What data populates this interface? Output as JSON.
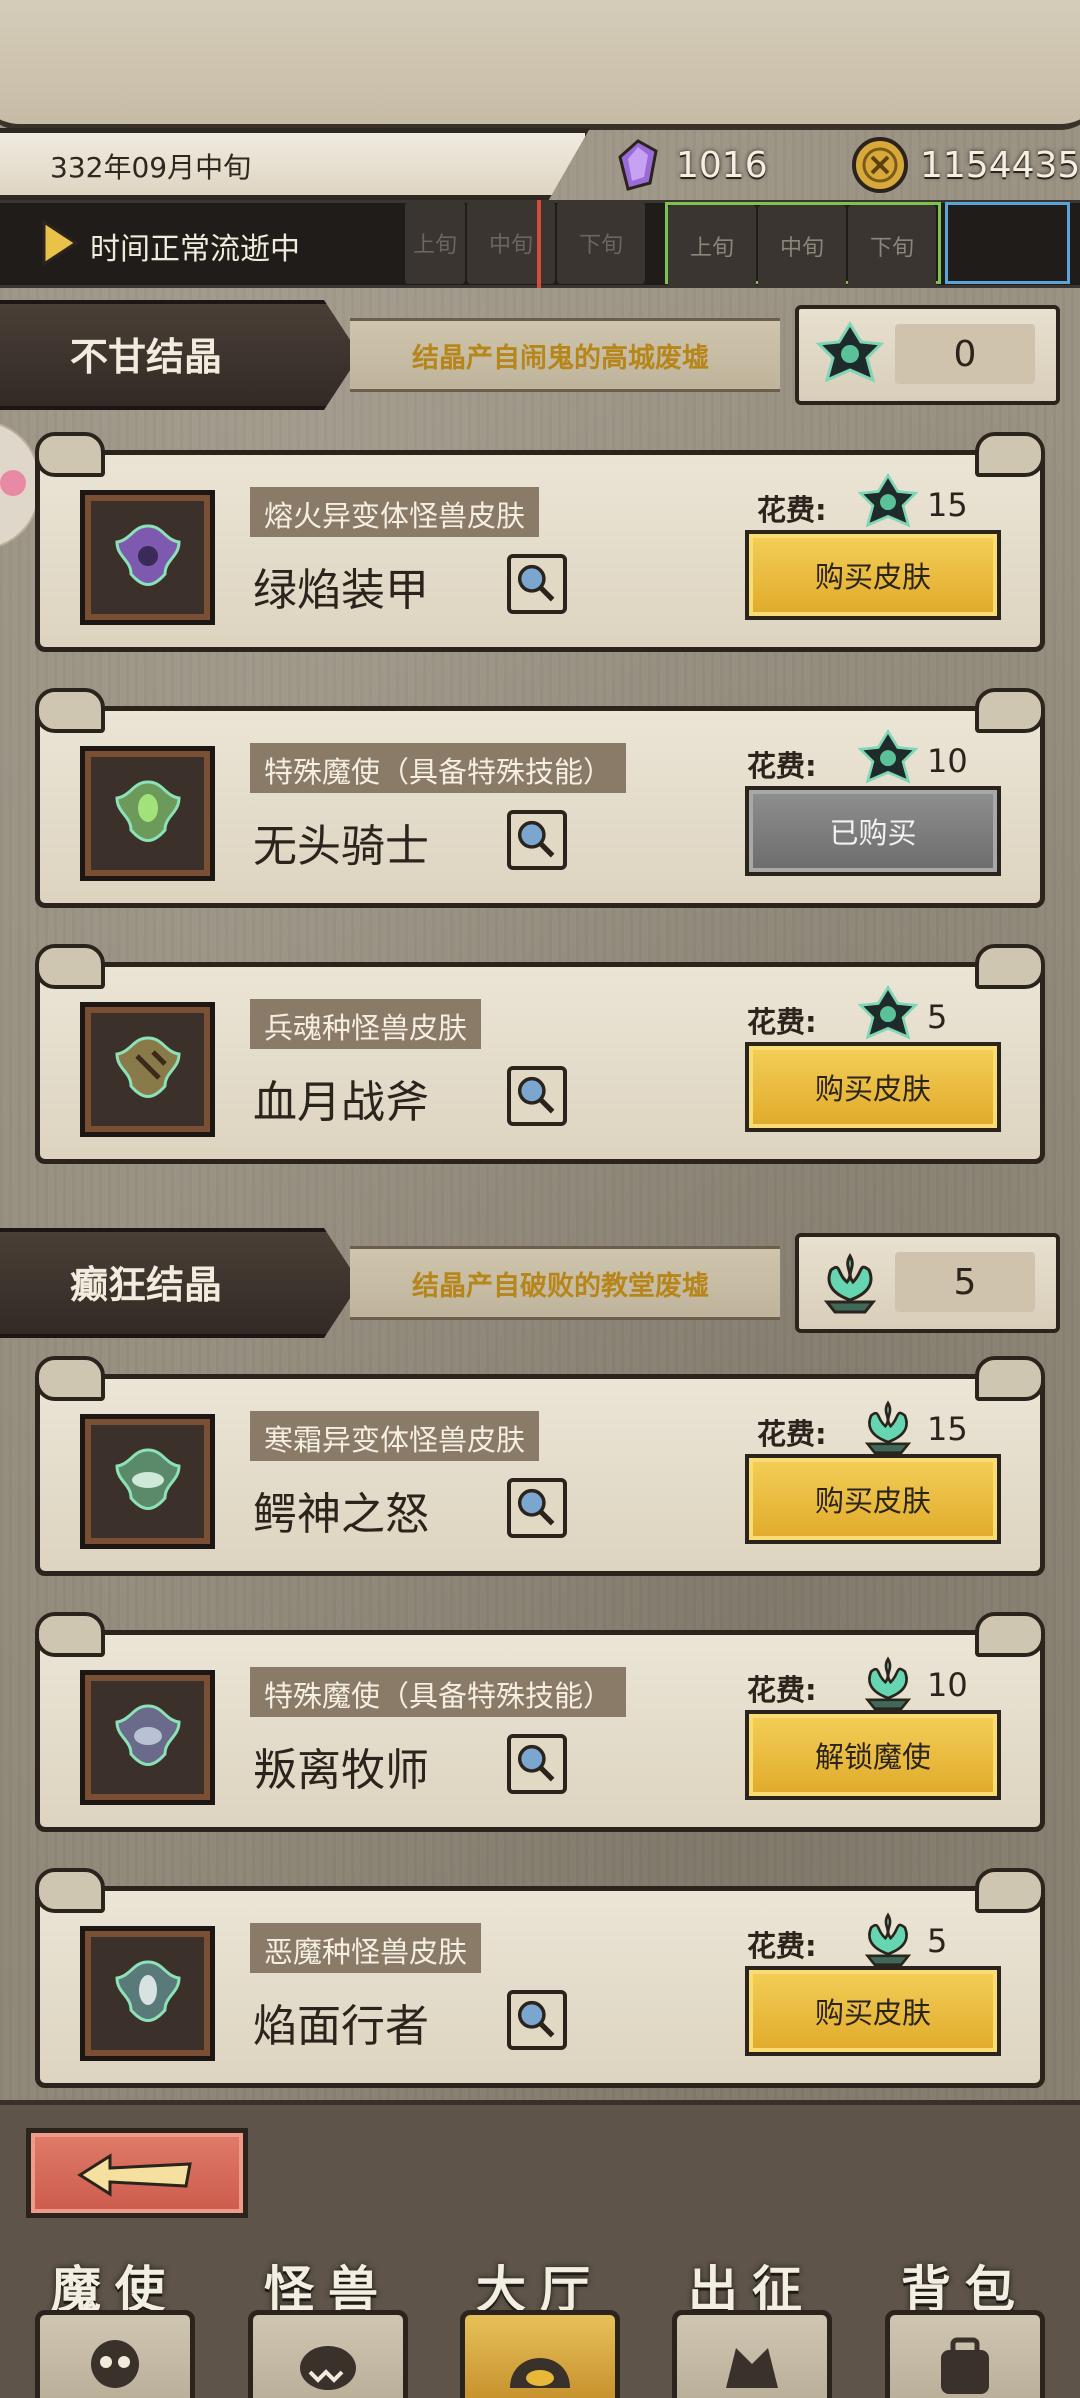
{
  "header": {
    "date": "332年09月中旬",
    "gems": "1016",
    "coins": "1154435",
    "time_status": "时间正常流逝中",
    "segments": [
      "上旬",
      "中旬",
      "下旬",
      "上旬",
      "中旬",
      "下旬"
    ]
  },
  "sections": [
    {
      "title": "不甘结晶",
      "desc": "结晶产自闹鬼的高城废墟",
      "count": "0",
      "items": [
        {
          "tag": "熔火异变体怪兽皮肤",
          "name": "绿焰装甲",
          "cost_label": "花费:",
          "cost": "15",
          "button": "购买皮肤",
          "state": "buy"
        },
        {
          "tag": "特殊魔使（具备特殊技能）",
          "name": "无头骑士",
          "cost_label": "花费:",
          "cost": "10",
          "button": "已购买",
          "state": "owned"
        },
        {
          "tag": "兵魂种怪兽皮肤",
          "name": "血月战斧",
          "cost_label": "花费:",
          "cost": "5",
          "button": "购买皮肤",
          "state": "buy"
        }
      ]
    },
    {
      "title": "癫狂结晶",
      "desc": "结晶产自破败的教堂废墟",
      "count": "5",
      "items": [
        {
          "tag": "寒霜异变体怪兽皮肤",
          "name": "鳄神之怒",
          "cost_label": "花费:",
          "cost": "15",
          "button": "购买皮肤",
          "state": "buy"
        },
        {
          "tag": "特殊魔使（具备特殊技能）",
          "name": "叛离牧师",
          "cost_label": "花费:",
          "cost": "10",
          "button": "解锁魔使",
          "state": "buy"
        },
        {
          "tag": "恶魔种怪兽皮肤",
          "name": "焰面行者",
          "cost_label": "花费:",
          "cost": "5",
          "button": "购买皮肤",
          "state": "buy"
        }
      ]
    }
  ],
  "nav": [
    {
      "label": "魔使",
      "icon": "skull-icon"
    },
    {
      "label": "怪兽",
      "icon": "monster-icon"
    },
    {
      "label": "大厅",
      "icon": "hall-icon",
      "active": true
    },
    {
      "label": "出征",
      "icon": "expedition-icon"
    },
    {
      "label": "背包",
      "icon": "backpack-icon"
    }
  ],
  "colors": {
    "gold_button": "#e8b838",
    "owned_button": "#7b7b7b",
    "desc_text": "#b7861b"
  }
}
